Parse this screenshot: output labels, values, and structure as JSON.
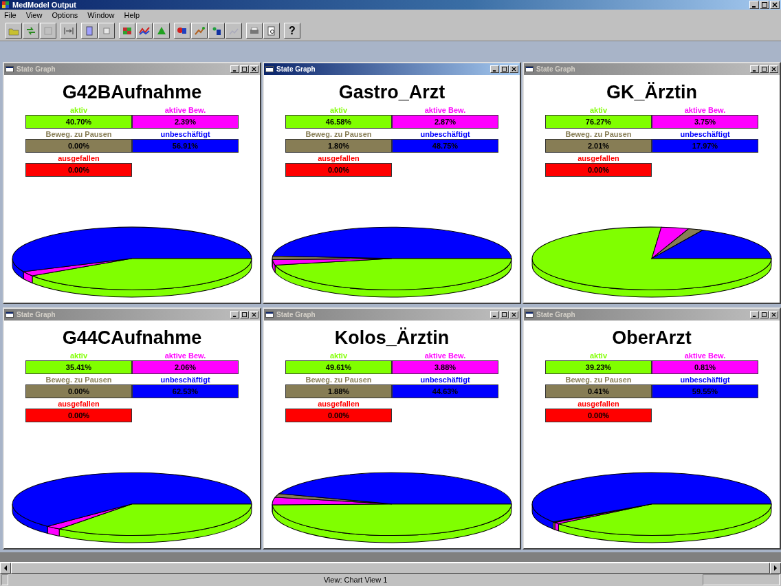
{
  "app": {
    "title": "MedModel Output"
  },
  "menu": [
    "File",
    "View",
    "Options",
    "Window",
    "Help"
  ],
  "toolbar": {
    "help": "?"
  },
  "windows": [
    {
      "title": "State Graph",
      "selected": false,
      "name": "G42BAufnahme",
      "states": [
        {
          "label": "aktiv",
          "value": "40.70%",
          "color": "#80ff00"
        },
        {
          "label": "aktive Bew.",
          "value": "2.39%",
          "color": "#ff00ff"
        },
        {
          "label": "Beweg. zu Pausen",
          "value": "0.00%",
          "color": "#877d55"
        },
        {
          "label": "unbeschäftigt",
          "value": "56.91%",
          "color": "#0000ff"
        },
        {
          "label": "ausgefallen",
          "value": "0.00%",
          "color": "#ff0000"
        }
      ]
    },
    {
      "title": "State Graph",
      "selected": true,
      "name": "Gastro_Arzt",
      "states": [
        {
          "label": "aktiv",
          "value": "46.58%",
          "color": "#80ff00"
        },
        {
          "label": "aktive Bew.",
          "value": "2.87%",
          "color": "#ff00ff"
        },
        {
          "label": "Beweg. zu Pausen",
          "value": "1.80%",
          "color": "#877d55"
        },
        {
          "label": "unbeschäftigt",
          "value": "48.75%",
          "color": "#0000ff"
        },
        {
          "label": "ausgefallen",
          "value": "0.00%",
          "color": "#ff0000"
        }
      ]
    },
    {
      "title": "State Graph",
      "selected": false,
      "name": "GK_Ärztin",
      "states": [
        {
          "label": "aktiv",
          "value": "76.27%",
          "color": "#80ff00"
        },
        {
          "label": "aktive Bew.",
          "value": "3.75%",
          "color": "#ff00ff"
        },
        {
          "label": "Beweg. zu Pausen",
          "value": "2.01%",
          "color": "#877d55"
        },
        {
          "label": "unbeschäftigt",
          "value": "17.97%",
          "color": "#0000ff"
        },
        {
          "label": "ausgefallen",
          "value": "0.00%",
          "color": "#ff0000"
        }
      ]
    },
    {
      "title": "State Graph",
      "selected": false,
      "name": "G44CAufnahme",
      "states": [
        {
          "label": "aktiv",
          "value": "35.41%",
          "color": "#80ff00"
        },
        {
          "label": "aktive Bew.",
          "value": "2.06%",
          "color": "#ff00ff"
        },
        {
          "label": "Beweg. zu Pausen",
          "value": "0.00%",
          "color": "#877d55"
        },
        {
          "label": "unbeschäftigt",
          "value": "62.53%",
          "color": "#0000ff"
        },
        {
          "label": "ausgefallen",
          "value": "0.00%",
          "color": "#ff0000"
        }
      ]
    },
    {
      "title": "State Graph",
      "selected": false,
      "name": "Kolos_Ärztin",
      "states": [
        {
          "label": "aktiv",
          "value": "49.61%",
          "color": "#80ff00"
        },
        {
          "label": "aktive Bew.",
          "value": "3.88%",
          "color": "#ff00ff"
        },
        {
          "label": "Beweg. zu Pausen",
          "value": "1.88%",
          "color": "#877d55"
        },
        {
          "label": "unbeschäftigt",
          "value": "44.63%",
          "color": "#0000ff"
        },
        {
          "label": "ausgefallen",
          "value": "0.00%",
          "color": "#ff0000"
        }
      ]
    },
    {
      "title": "State Graph",
      "selected": false,
      "name": "OberArzt",
      "states": [
        {
          "label": "aktiv",
          "value": "39.23%",
          "color": "#80ff00"
        },
        {
          "label": "aktive Bew.",
          "value": "0.81%",
          "color": "#ff00ff"
        },
        {
          "label": "Beweg. zu Pausen",
          "value": "0.41%",
          "color": "#877d55"
        },
        {
          "label": "unbeschäftigt",
          "value": "59.55%",
          "color": "#0000ff"
        },
        {
          "label": "ausgefallen",
          "value": "0.00%",
          "color": "#ff0000"
        }
      ]
    }
  ],
  "status_bar": {
    "text": "View:  Chart View 1"
  }
}
